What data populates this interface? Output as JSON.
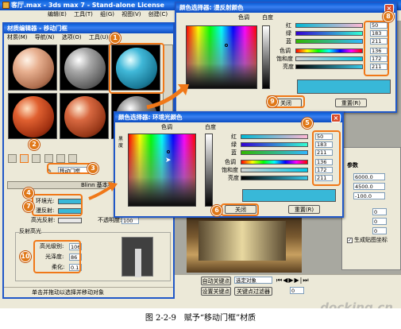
{
  "main_window": {
    "title": "客厅.max - 3ds max 7 - Stand-alone License",
    "menus": [
      "编辑(E)",
      "工具(T)",
      "组(G)",
      "视图(V)",
      "创建(C)",
      "修改"
    ]
  },
  "material_editor": {
    "title": "材质编辑器 - 移动门框",
    "menus": [
      "材质(M)",
      "导航(N)",
      "选项(O)",
      "工具(U)"
    ],
    "material_name": "移动门框",
    "shader_rollout": "Blinn 基本参数",
    "ambient_label": "环境光:",
    "diffuse_label": "漫反射:",
    "specular_label": "高光反射:",
    "opacity_label": "不透明度:",
    "opacity_value": "100",
    "highlights_title": "反射高光",
    "spec_level_label": "高光级别:",
    "spec_level_value": "106",
    "glossiness_label": "光泽度:",
    "glossiness_value": "86",
    "soften_label": "柔化:",
    "soften_value": "0.1",
    "status_text": "单击并拖动以选择并移动对象"
  },
  "diffuse_dialog": {
    "title": "颜色选择器: 漫反射颜色",
    "hue_label": "色调",
    "whiteness_label": "白度",
    "labels": [
      "红",
      "绿",
      "蓝",
      "色调",
      "饱和度",
      "亮度"
    ],
    "values": [
      "50",
      "183",
      "211",
      "136",
      "172",
      "211"
    ],
    "close": "关闭",
    "reset": "重置(R)"
  },
  "ambient_dialog": {
    "title": "颜色选择器: 环境光颜色",
    "hue_label": "色调",
    "whiteness_label": "白度",
    "blackness_label": "黑度",
    "labels": [
      "红",
      "绿",
      "蓝",
      "色调",
      "饱和度",
      "亮度"
    ],
    "values": [
      "50",
      "183",
      "211",
      "136",
      "172",
      "211"
    ],
    "close": "关闭",
    "reset": "重置(R)"
  },
  "right_panel": {
    "params_title": "参数",
    "values": [
      "6000.0",
      "4500.0",
      "-100.0",
      "0",
      "0",
      "0"
    ],
    "checkbox_label": "生成贴图坐标"
  },
  "bottom_bar": {
    "auto_key": "自动关键点",
    "set_key": "设置关键点",
    "key_filters": "关键点过滤器",
    "selection": "选定对象",
    "frame": "0"
  },
  "callouts": [
    "1",
    "2",
    "3",
    "4",
    "5",
    "6",
    "7",
    "8",
    "9",
    "10"
  ],
  "caption": "图 2-2-9　赋予“移动门框”材质",
  "watermark": "docking.cn",
  "colors": {
    "swatch": "#38b8d8",
    "callout": "#e07818",
    "titlebar": "#0a5fd8"
  }
}
